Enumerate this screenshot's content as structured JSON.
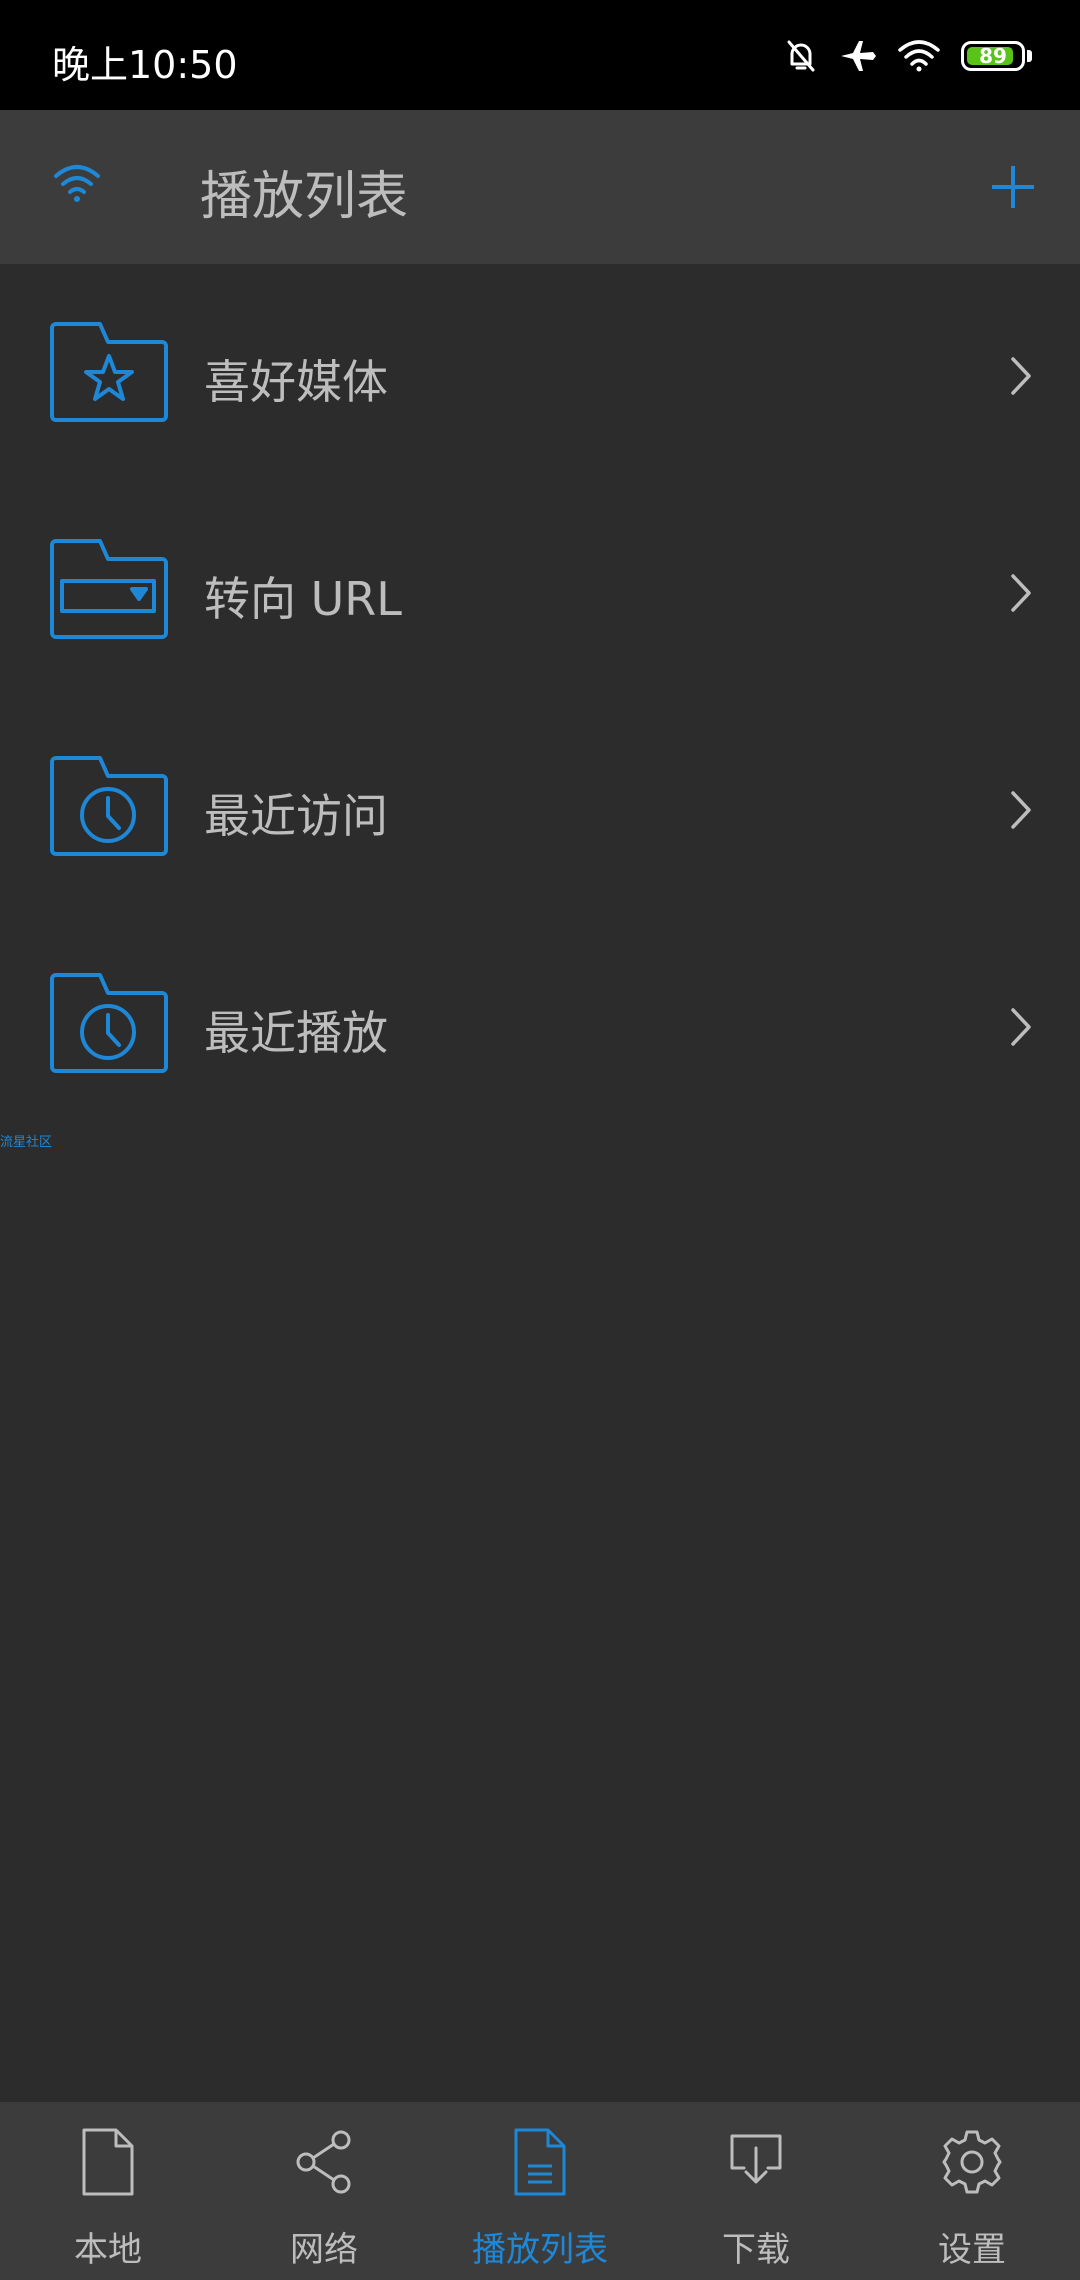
{
  "status_bar": {
    "time": "晚上10:50",
    "battery_level": "89",
    "battery_color": "#5ac31a"
  },
  "header": {
    "title": "播放列表",
    "wifi_icon": "wifi-icon",
    "add_icon": "plus-icon"
  },
  "accent_color": "#1e88d6",
  "playlists": [
    {
      "label": "喜好媒体",
      "icon": "folder-star-icon"
    },
    {
      "label": "转向 URL",
      "icon": "folder-url-icon"
    },
    {
      "label": "最近访问",
      "icon": "folder-clock-icon"
    },
    {
      "label": "最近播放",
      "icon": "folder-clock-icon"
    }
  ],
  "community_link": "流星社区",
  "bottom_nav": [
    {
      "label": "本地",
      "icon": "file-icon",
      "active": false
    },
    {
      "label": "网络",
      "icon": "share-icon",
      "active": false
    },
    {
      "label": "播放列表",
      "icon": "playlist-icon",
      "active": true
    },
    {
      "label": "下载",
      "icon": "download-icon",
      "active": false
    },
    {
      "label": "设置",
      "icon": "gear-icon",
      "active": false
    }
  ]
}
